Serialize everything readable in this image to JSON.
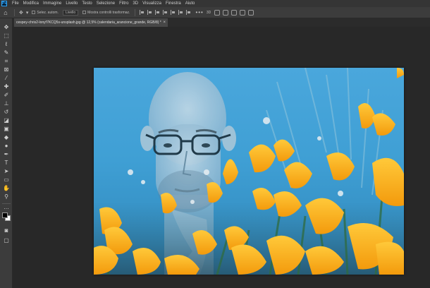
{
  "app": {
    "logo_text": "Ps",
    "menu": [
      "File",
      "Modifica",
      "Immagine",
      "Livello",
      "Testo",
      "Selezione",
      "Filtro",
      "3D",
      "Visualizza",
      "Finestra",
      "Aiuto"
    ]
  },
  "options_bar": {
    "auto_select_label": "Selez. autom.",
    "auto_select_target": "Livello",
    "show_transform_label": "Mostra controlli trasformaz.",
    "more_label": "•••"
  },
  "document": {
    "tab_title": "cespey-chris2-lonyf7KCQ5s-unsplash.jpg @ 12,5% (calendaria_arancione_grande, RGB/8) *",
    "close_label": "×"
  },
  "tools": [
    {
      "name": "move-tool-icon",
      "glyph": "✥"
    },
    {
      "name": "marquee-tool-icon",
      "glyph": "⬚"
    },
    {
      "name": "lasso-tool-icon",
      "glyph": "ℓ"
    },
    {
      "name": "quick-select-tool-icon",
      "glyph": "✎"
    },
    {
      "name": "crop-tool-icon",
      "glyph": "⌗"
    },
    {
      "name": "frame-tool-icon",
      "glyph": "⊠"
    },
    {
      "name": "eyedropper-tool-icon",
      "glyph": "⁄"
    },
    {
      "name": "healing-brush-tool-icon",
      "glyph": "✚"
    },
    {
      "name": "brush-tool-icon",
      "glyph": "✐"
    },
    {
      "name": "clone-stamp-tool-icon",
      "glyph": "⊥"
    },
    {
      "name": "history-brush-tool-icon",
      "glyph": "↺"
    },
    {
      "name": "eraser-tool-icon",
      "glyph": "◪"
    },
    {
      "name": "gradient-tool-icon",
      "glyph": "▣"
    },
    {
      "name": "blur-tool-icon",
      "glyph": "◆"
    },
    {
      "name": "dodge-tool-icon",
      "glyph": "●"
    },
    {
      "name": "pen-tool-icon",
      "glyph": "✒"
    },
    {
      "name": "type-tool-icon",
      "glyph": "T"
    },
    {
      "name": "path-select-tool-icon",
      "glyph": "➤"
    },
    {
      "name": "shape-tool-icon",
      "glyph": "▭"
    },
    {
      "name": "hand-tool-icon",
      "glyph": "✋"
    },
    {
      "name": "zoom-tool-icon",
      "glyph": "⚲"
    },
    {
      "name": "extra-tools-icon",
      "glyph": "…"
    }
  ]
}
